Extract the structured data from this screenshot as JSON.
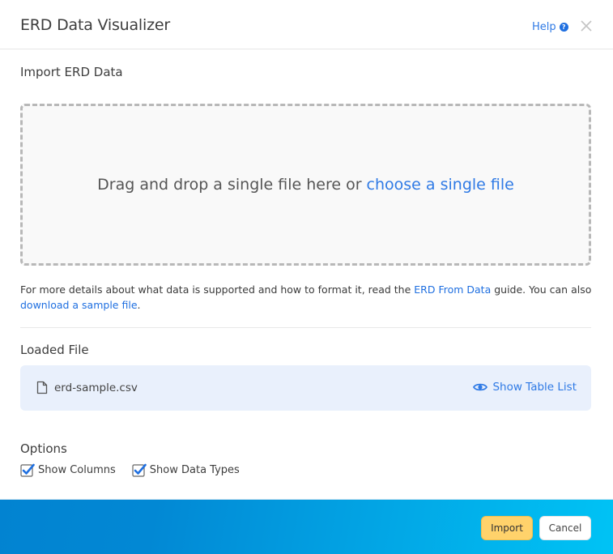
{
  "header": {
    "title": "ERD Data Visualizer",
    "help_label": "Help",
    "help_icon": "question-circle-icon",
    "close_icon": "close-icon"
  },
  "import_section": {
    "label": "Import ERD Data",
    "dropzone_text": "Drag and drop a single file here or",
    "dropzone_link": "choose a single file"
  },
  "info": {
    "text_before": "For more details about what data is supported and how to format it, read the ",
    "guide_link": "ERD From Data",
    "text_middle": " guide. You can also ",
    "sample_link": "download a sample file",
    "text_after": "."
  },
  "loaded_file": {
    "label": "Loaded File",
    "file_icon": "file-icon",
    "file_name": "erd-sample.csv",
    "show_tables_icon": "eye-icon",
    "show_tables_label": "Show Table List"
  },
  "options": {
    "label": "Options",
    "items": [
      {
        "label": "Show Columns",
        "checked": true
      },
      {
        "label": "Show Data Types",
        "checked": true
      }
    ]
  },
  "footer": {
    "import_label": "Import",
    "cancel_label": "Cancel"
  },
  "colors": {
    "accent_link": "#2f7ae5",
    "import_button": "#ffd26b",
    "file_panel": "#e9f0fc",
    "footer_gradient_start": "#0283d1",
    "footer_gradient_end": "#00c3f5"
  }
}
